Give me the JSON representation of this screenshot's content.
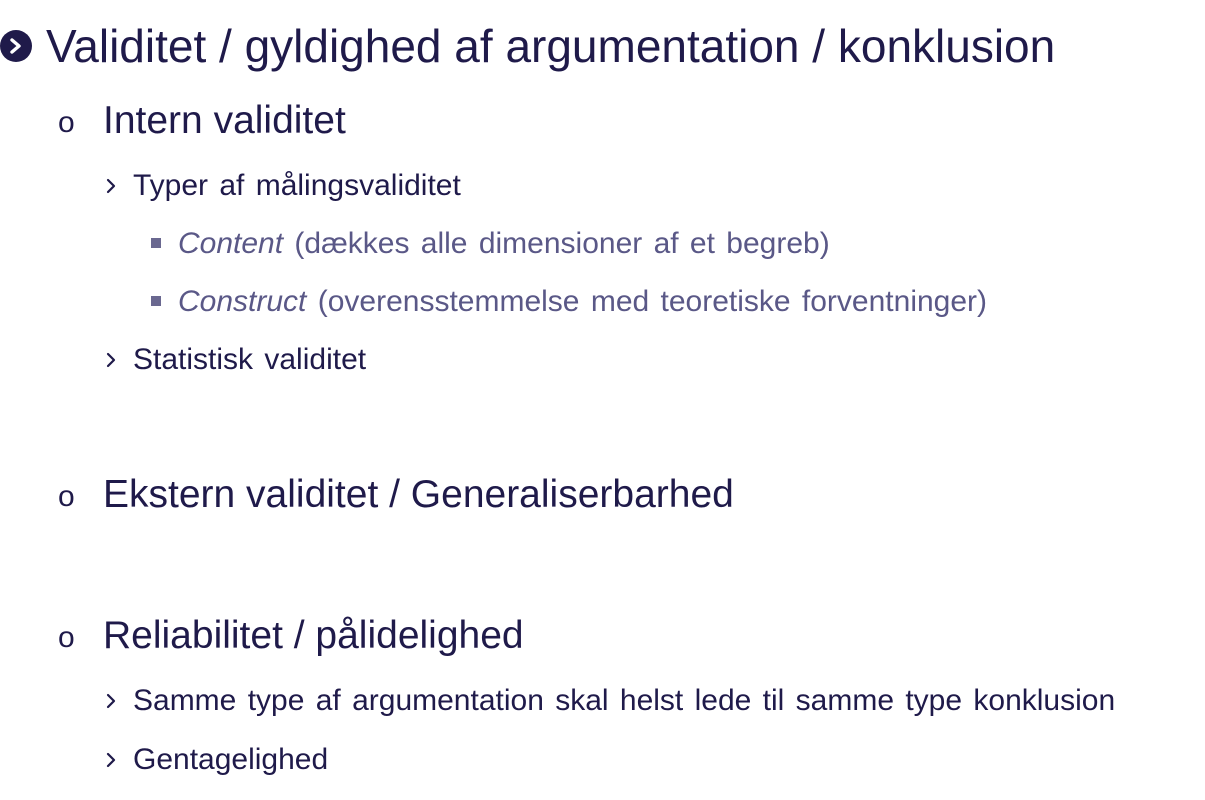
{
  "slide": {
    "title": "Validitet / gyldighed af argumentation / konklusion",
    "sections": [
      {
        "heading": "Intern validitet",
        "items": [
          {
            "text": "Typer af målingsvaliditet",
            "subitems": [
              {
                "term": "Content",
                "description": "(dækkes alle dimensioner af et begreb)"
              },
              {
                "term": "Construct",
                "description": "(overensstemmelse med teoretiske forventninger)"
              }
            ]
          },
          {
            "text": "Statistisk validitet"
          }
        ]
      },
      {
        "heading": "Ekstern validitet / Generaliserbarhed"
      },
      {
        "heading": "Reliabilitet / pålidelighed",
        "items": [
          {
            "text": "Samme type af argumentation skal helst lede til samme type konklusion"
          },
          {
            "text": "Gentagelighed"
          }
        ]
      }
    ],
    "bullets": {
      "level1_icon": "chevron-right-circle-icon",
      "level2_icon": "circle-outline-icon",
      "level3_icon": "chevron-right-icon",
      "level4_icon": "square-icon"
    },
    "colors": {
      "primary_text": "#1f1a4a",
      "secondary_text": "#5a5887"
    }
  }
}
